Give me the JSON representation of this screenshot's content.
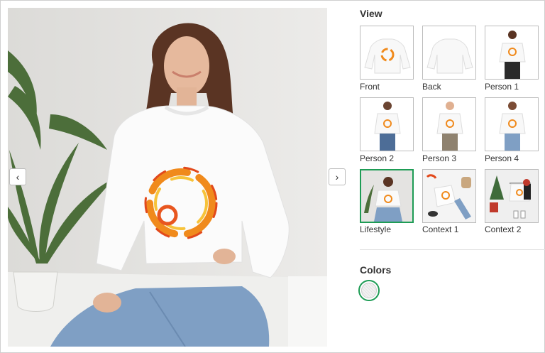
{
  "view": {
    "heading": "View",
    "thumbnails": [
      {
        "label": "Front"
      },
      {
        "label": "Back"
      },
      {
        "label": "Person 1"
      },
      {
        "label": "Person 2"
      },
      {
        "label": "Person 3"
      },
      {
        "label": "Person 4"
      },
      {
        "label": "Lifestyle",
        "selected": true
      },
      {
        "label": "Context 1"
      },
      {
        "label": "Context 2"
      }
    ]
  },
  "colors": {
    "heading": "Colors",
    "options": [
      {
        "name": "white",
        "hex": "#f2f2f2",
        "selected": true
      }
    ]
  },
  "navigation": {
    "prev_icon": "‹",
    "next_icon": "›"
  },
  "accent": "#1e9c55"
}
